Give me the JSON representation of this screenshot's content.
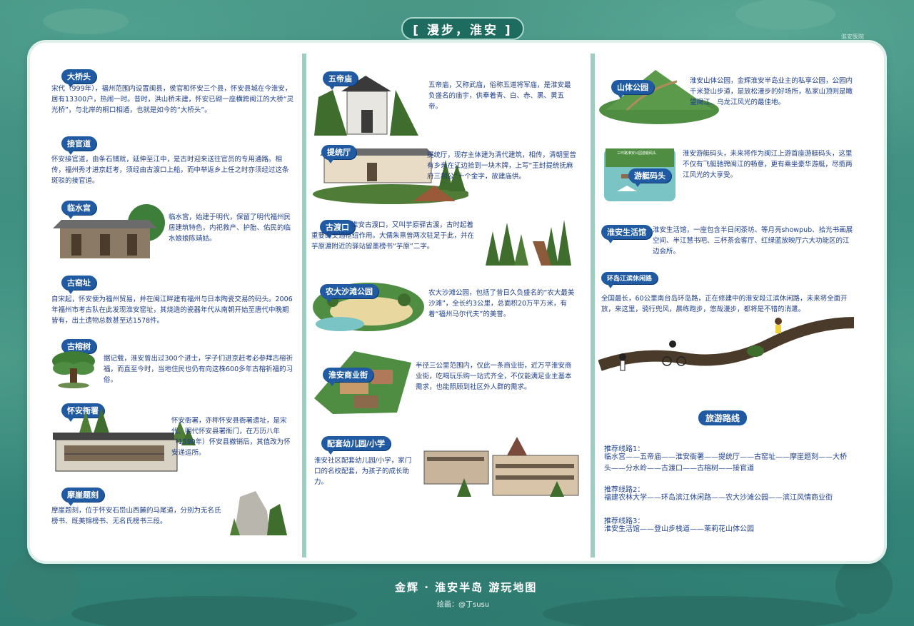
{
  "title": "[ 漫步，淮安 ]",
  "top_right_label": "淮安医院",
  "footer": {
    "title": "金辉 · 淮安半岛 游玩地图",
    "author": "绘画：@丁susu"
  },
  "col1": [
    {
      "name": "大桥头",
      "text": "宋代（999年），福州范围内设置闽县，侯官和怀安三个县，怀安县城在今淮安，居有13300户，热闹一时。昔时，洪山桥未建，怀安已砌一座横跨闽江的大桥“灵光桥”，与北岸的桐口相通，也就是如今的“大桥头”。"
    },
    {
      "name": "接官道",
      "text": "怀安接官道，由条石铺就，延伸至江中，是古时迎来送往官员的专用通路。相传，福州秀才进京赶考，须经由古渡口上船，而中举返乡上任之时亦须经过这条斑驳的接官道。"
    },
    {
      "name": "临水宫",
      "text": "临水宫，始建于明代，保留了明代福州民居建筑特色，内祀救产、护胎、佑民的临水娘娘陈靖姑。"
    },
    {
      "name": "古窑址",
      "text": "自宋起，怀安便为福州贸易，并在闽江畔建有福州与日本陶瓷交易的码头。2006年福州市考古队在此发现淮安窑址，其烧造的瓷器年代从南朝开始至唐代中晚期皆有，出土遗物总数甚至达1578件。"
    },
    {
      "name": "古榕树",
      "text": "据记载，淮安曾出过300个进士，学子们进京赶考必参拜古榕祈福，而直至今时，当地住民也仍有向这株600多年古榕祈福的习俗。"
    },
    {
      "name": "怀安衙署",
      "text": "怀安衙署，亦称怀安县衙署遗址，是宋代、明代怀安县署衙门，在万历八年（1580年）怀安县撤销后，其值改为怀安递运所。"
    },
    {
      "name": "摩崖题刻",
      "text": "摩崖题刻，位于怀安石岊山西麓的马尾道，分别为无名氏榜书、既美锦榜书、无名氏榜书三段。"
    }
  ],
  "col2": [
    {
      "name": "五帝庙",
      "text": "五帝庙，又称武庙，俗称五道将军庙，是淮安最负盛名的庙宇，供奉着青、白、赤、黑、黄五帝。"
    },
    {
      "name": "提统厅",
      "text": "提统厅，现存主体建为清代建筑，相传，清朝里曾有乡亲在江边拾到一块木牌，上写“王封提统抚麻府三相公”十个金字，故建庙供。"
    },
    {
      "name": "古渡口",
      "text": "淮安古渡口，又叫芋原驿古渡，古时起着重要的交通枢纽作用。大儒朱熹曾两次驻足于此，并在芋原渡附近的驿站留墨榜书“芋原”二字。"
    },
    {
      "name": "农大沙滩公园",
      "text": "农大沙滩公园，包括了昔日久负盛名的“农大最美沙滩”，全长约3公里，总面积20万平方米，有着“福州马尔代夫”的美誉。"
    },
    {
      "name": "淮安商业街",
      "text": "半径三公里范围内，仅此一条商业街，近万平淮安商业街，吃喝玩乐购一站式齐全，不仅能满足业主基本需求，也能照顾到社区外人群的需求。"
    },
    {
      "name": "配套幼儿园/小学",
      "text": "淮安社区配套幼儿园/小学，家门口的名校配套，为孩子的成长助力。"
    }
  ],
  "col3": [
    {
      "name": "山体公园",
      "text": "淮安山体公园，金辉淮安半岛业主的私享公园，公园内千米登山步道，是放松漫步的好场所，私家山顶则是瞰望闽江、乌龙江风光的最佳地。"
    },
    {
      "name": "游艇码头",
      "text": "淮安游艇码头，未来将作为闽江上游首座游艇码头，这里不仅有飞艇驰骋闽江的畅意，更有乘坐豪华游艇，尽揽两江风光的大享受。",
      "sign": "三环路淮安公园游艇码头"
    },
    {
      "name": "淮安生活馆",
      "text": "淮安生活馆，一座包含半日闲茶坊、等月亮showpub、拾光书画展空间、半江慧书吧、三杯茶会客厅、红绿蓝放映厅六大功能区的江边会所。"
    },
    {
      "name": "环岛江滨休闲路",
      "text": "全国最长，60公里南台岛环岛路，正在修建中的淮安段江滨休闲路，未来将全面开放，来这里，骑行兜风，晨练跑步，悠哉漫步，都将是不错的消遣。"
    }
  ],
  "routes": {
    "heading": "旅游路线",
    "items": [
      {
        "label": "推荐线路1：",
        "text": "临水宫——五帝庙——淮安衙署——提统厅——古窑址——摩崖题刻——大桥头——分水岭——古渡口——古榕树——接官道"
      },
      {
        "label": "推荐线路2：",
        "text": "福建农林大学——环岛滨江休闲路——农大沙滩公园——滨江风情商业街"
      },
      {
        "label": "推荐线路3：",
        "text": "淮安生活馆——登山步栈道——茉莉花山体公园"
      }
    ]
  }
}
